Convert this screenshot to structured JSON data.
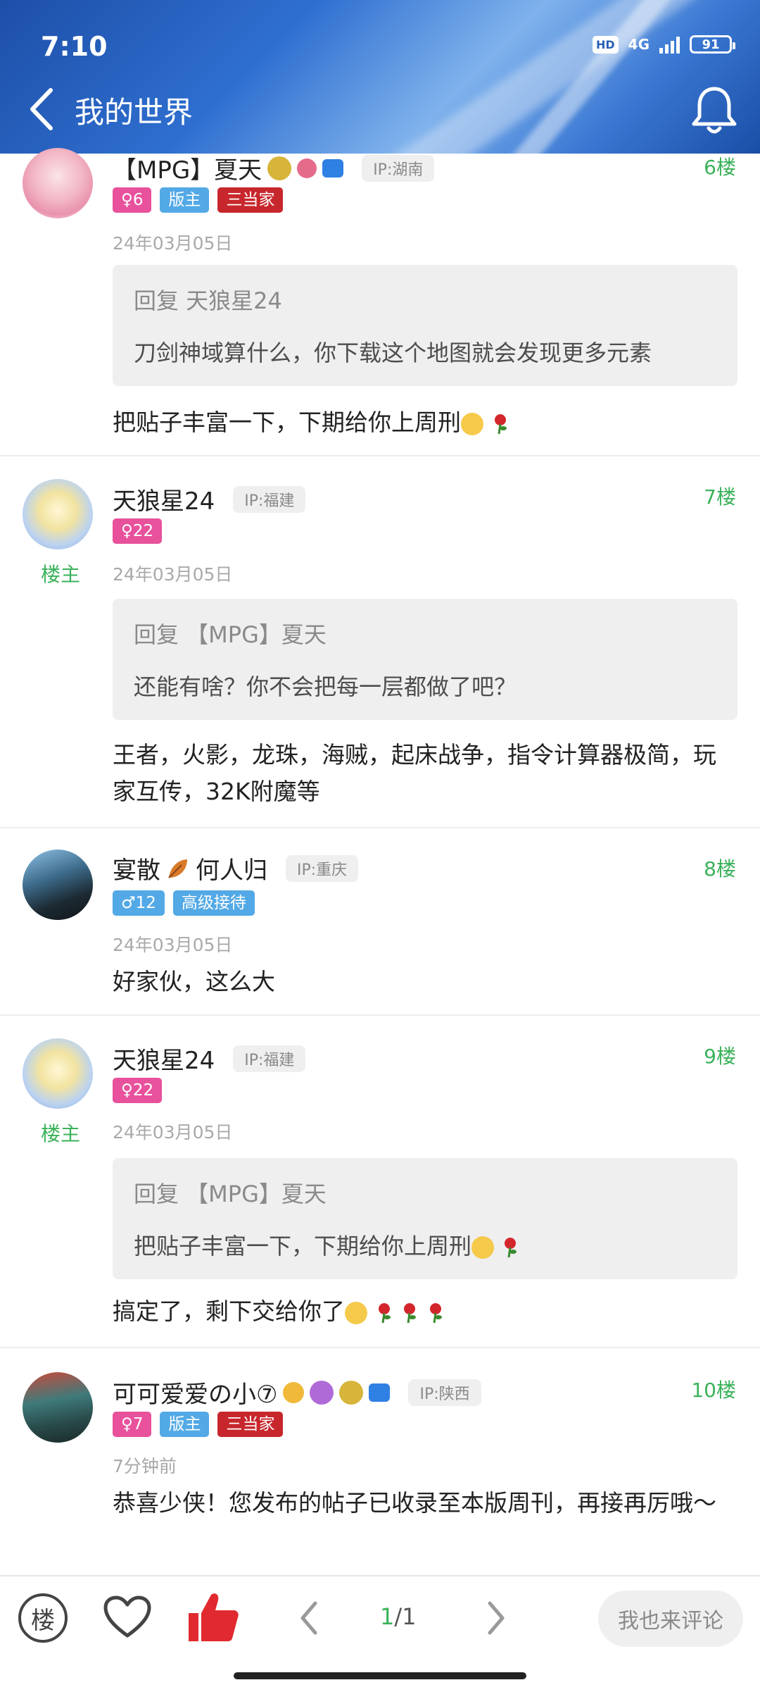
{
  "status_bar": {
    "time": "7:10",
    "hd": "HD",
    "network": "4G",
    "battery": "91"
  },
  "header": {
    "title": "我的世界"
  },
  "posts": [
    {
      "username": "【MPG】夏天",
      "ip": "IP:湖南",
      "floor": "6楼",
      "badges": [
        "♀6",
        "版主",
        "三当家"
      ],
      "date": "24年03月05日",
      "quote_header": "回复 天狼星24",
      "quote_body": "刀剑神域算什么，你下载这个地图就会发现更多元素",
      "body": "把贴子丰富一下，下期给你上周刑"
    },
    {
      "username": "天狼星24",
      "ip": "IP:福建",
      "floor": "7楼",
      "host_tag": "楼主",
      "badges": [
        "♀22"
      ],
      "date": "24年03月05日",
      "quote_header": "回复 【MPG】夏天",
      "quote_body": "还能有啥？你不会把每一层都做了吧？",
      "body": "王者，火影，龙珠，海贼，起床战争，指令计算器极简，玩家互传，32K附魔等"
    },
    {
      "username": "宴散",
      "username_suffix": "何人归",
      "ip": "IP:重庆",
      "floor": "8楼",
      "badges": [
        "♂12",
        "高级接待"
      ],
      "date": "24年03月05日",
      "body": "好家伙，这么大"
    },
    {
      "username": "天狼星24",
      "ip": "IP:福建",
      "floor": "9楼",
      "host_tag": "楼主",
      "badges": [
        "♀22"
      ],
      "date": "24年03月05日",
      "quote_header": "回复 【MPG】夏天",
      "quote_body": "把贴子丰富一下，下期给你上周刑",
      "body": "搞定了，剩下交给你了"
    },
    {
      "username": "可可爱爱の小⑦",
      "ip": "IP:陕西",
      "floor": "10楼",
      "badges": [
        "♀7",
        "版主",
        "三当家"
      ],
      "date": "7分钟前",
      "body": "恭喜少侠！您发布的帖子已收录至本版周刊，再接再厉哦～"
    }
  ],
  "bottom_bar": {
    "floor_button": "楼",
    "page_current": "1",
    "page_total": "/1",
    "comment_button": "我也来评论"
  },
  "colors": {
    "accent_green": "#3bb25a",
    "badge_pink": "#e8519c",
    "badge_blue": "#53a9e6",
    "badge_red": "#c7272c"
  }
}
